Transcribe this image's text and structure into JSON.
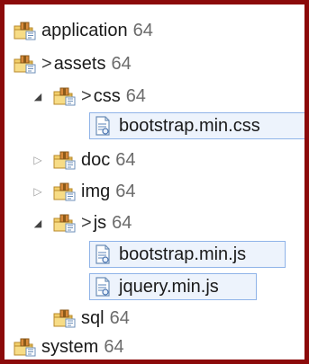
{
  "tree": {
    "application": {
      "name": "application",
      "rev": "64"
    },
    "assets": {
      "dec": ">",
      "name": "assets",
      "rev": "64"
    },
    "css": {
      "dec": ">",
      "name": "css",
      "rev": "64"
    },
    "bootstrap_css": {
      "name": "bootstrap.min.css"
    },
    "doc": {
      "name": "doc",
      "rev": "64"
    },
    "img": {
      "name": "img",
      "rev": "64"
    },
    "js": {
      "dec": ">",
      "name": "js",
      "rev": "64"
    },
    "bootstrap_js": {
      "name": "bootstrap.min.js"
    },
    "jquery_js": {
      "name": "jquery.min.js"
    },
    "sql": {
      "name": "sql",
      "rev": "64"
    },
    "system": {
      "name": "system",
      "rev": "64"
    }
  },
  "colors": {
    "frame": "#8b0a0a",
    "selection_border": "#8fb3e8",
    "selection_fill": "#edf3fc",
    "folder": "#f2cf6b"
  },
  "icons": {
    "expanded": "triangle-down",
    "collapsed": "triangle-right",
    "folder": "package-folder-icon",
    "file": "versioned-file-icon"
  }
}
